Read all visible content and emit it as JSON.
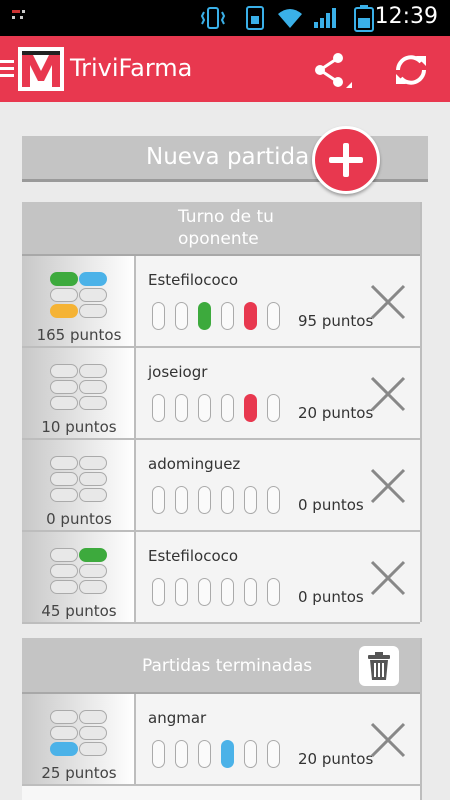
{
  "status": {
    "time": "12:39"
  },
  "colors": {
    "accent": "#e8384f",
    "green": "#3daa3d",
    "red": "#e8384f",
    "blue": "#4bb2e8",
    "orange": "#f5b335",
    "gray": "#c4c4c4"
  },
  "app": {
    "title": "TriviFarma"
  },
  "new_game": {
    "label": "Nueva partida"
  },
  "sections": {
    "opponent_turn": {
      "title_line1": "Turno de tu",
      "title_line2": "oponente",
      "games": [
        {
          "opponent": "Estefilococo",
          "points": "165 puntos",
          "score": "95 puntos",
          "pieces": [
            "green",
            "blue",
            "",
            "",
            "orange",
            ""
          ],
          "slots": [
            "",
            "",
            "green",
            "",
            "red",
            ""
          ]
        },
        {
          "opponent": "joseiogr",
          "points": "10 puntos",
          "score": "20 puntos",
          "pieces": [
            "",
            "",
            "",
            "",
            "",
            ""
          ],
          "slots": [
            "",
            "",
            "",
            "",
            "red",
            ""
          ]
        },
        {
          "opponent": "adominguez",
          "points": "0 puntos",
          "score": "0 puntos",
          "pieces": [
            "",
            "",
            "",
            "",
            "",
            ""
          ],
          "slots": [
            "",
            "",
            "",
            "",
            "",
            ""
          ]
        },
        {
          "opponent": "Estefilococo",
          "points": "45 puntos",
          "score": "0 puntos",
          "pieces": [
            "",
            "green",
            "",
            "",
            "",
            ""
          ],
          "slots": [
            "",
            "",
            "",
            "",
            "",
            ""
          ]
        }
      ]
    },
    "finished": {
      "title": "Partidas terminadas",
      "games": [
        {
          "opponent": "angmar",
          "points": "25 puntos",
          "score": "20 puntos",
          "pieces": [
            "",
            "",
            "",
            "",
            "blue",
            ""
          ],
          "slots": [
            "",
            "",
            "",
            "blue",
            "",
            ""
          ]
        }
      ]
    }
  }
}
